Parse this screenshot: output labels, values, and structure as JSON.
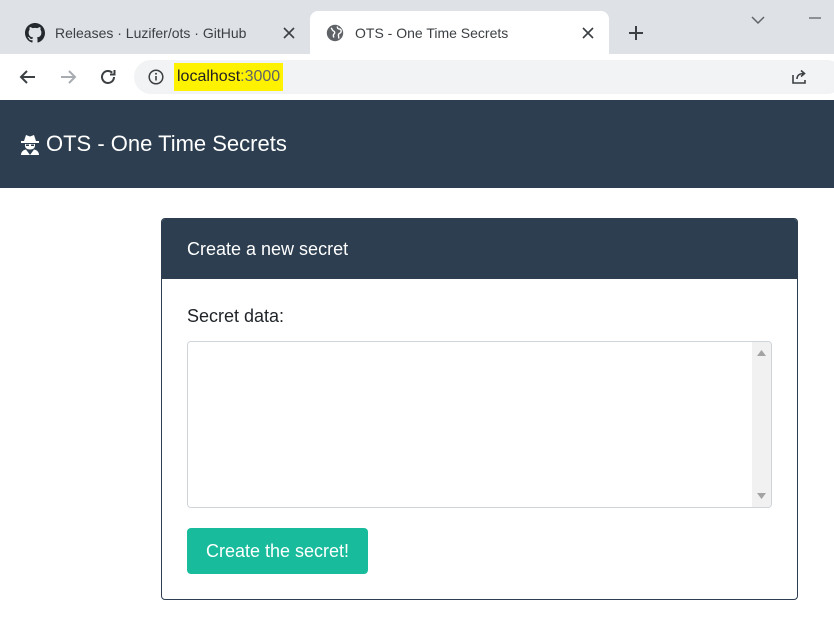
{
  "browser": {
    "tabs": [
      {
        "title": "Releases · Luzifer/ots · GitHub",
        "favicon": "github-icon",
        "active": false
      },
      {
        "title": "OTS - One Time Secrets",
        "favicon": "globe-icon",
        "active": true
      }
    ],
    "address": {
      "host": "localhost",
      "port": ":3000"
    }
  },
  "navbar": {
    "brand": "OTS - One Time Secrets",
    "brand_icon": "user-secret-icon"
  },
  "card": {
    "header": "Create a new secret",
    "field_label": "Secret data:",
    "textarea_value": "",
    "submit_label": "Create the secret!"
  },
  "colors": {
    "navbar": "#2c3e50",
    "accent": "#18bc9c",
    "url_highlight": "#fff200",
    "tabstrip": "#dee1e6"
  }
}
